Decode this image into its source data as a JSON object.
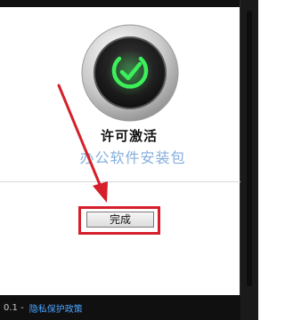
{
  "license": {
    "title": "许可激活",
    "watermark": "办公软件安装包",
    "done_label": "完成",
    "status_icon": "checkmark-check-icon",
    "accent_color": "#3cf05a",
    "highlight_color": "#d51f2a"
  },
  "footer": {
    "version_text": "0.1 -",
    "privacy_link": "隐私保护政策"
  }
}
